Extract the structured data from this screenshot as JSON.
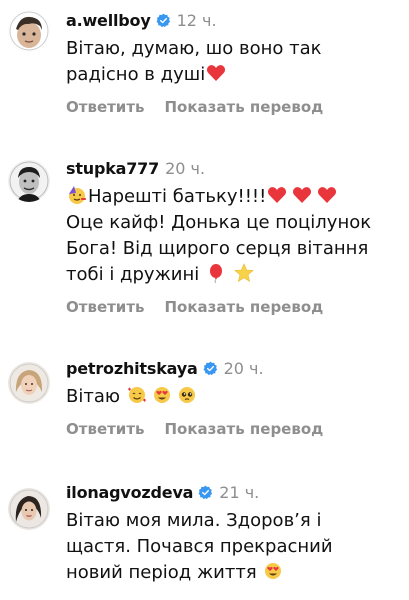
{
  "comments": [
    {
      "username": "a.wellboy",
      "verified": true,
      "time": "12 ч.",
      "lines": [
        "Вітаю, думаю, шо воно так",
        "радісно в душі"
      ],
      "reply_label": "Ответить",
      "translate_label": "Показать перевод"
    },
    {
      "username": "stupka777",
      "verified": false,
      "time": "20 ч.",
      "lines": [
        "Нарешті батьку!!!!",
        "Оце кайф! Донька це поцілунок",
        "Бога! Від щирого серця вітання",
        "тобі і дружині"
      ],
      "reply_label": "Ответить",
      "translate_label": "Показать перевод"
    },
    {
      "username": "petrozhitskaya",
      "verified": true,
      "time": "20 ч.",
      "lines": [
        "Вітаю"
      ],
      "reply_label": "Ответить",
      "translate_label": "Показать перевод"
    },
    {
      "username": "ilonagvozdeva",
      "verified": true,
      "time": "21 ч.",
      "lines": [
        "Вітаю моя мила. Здоров’я і",
        "щастя. Почався прекрасний",
        "новий період життя"
      ]
    }
  ],
  "colors": {
    "verified_blue": "#3897f0",
    "heart_red": "#e8363c",
    "muted_gray": "#8e8e8e"
  },
  "icons": {
    "verified": "verified-badge-icon",
    "heart": "red-heart-emoji",
    "party_face": "partying-face-emoji",
    "balloon": "balloon-emoji",
    "star": "star-emoji",
    "smiling_hearts": "smiling-face-with-hearts-emoji",
    "heart_eyes": "heart-eyes-emoji",
    "pleading": "pleading-face-emoji"
  }
}
